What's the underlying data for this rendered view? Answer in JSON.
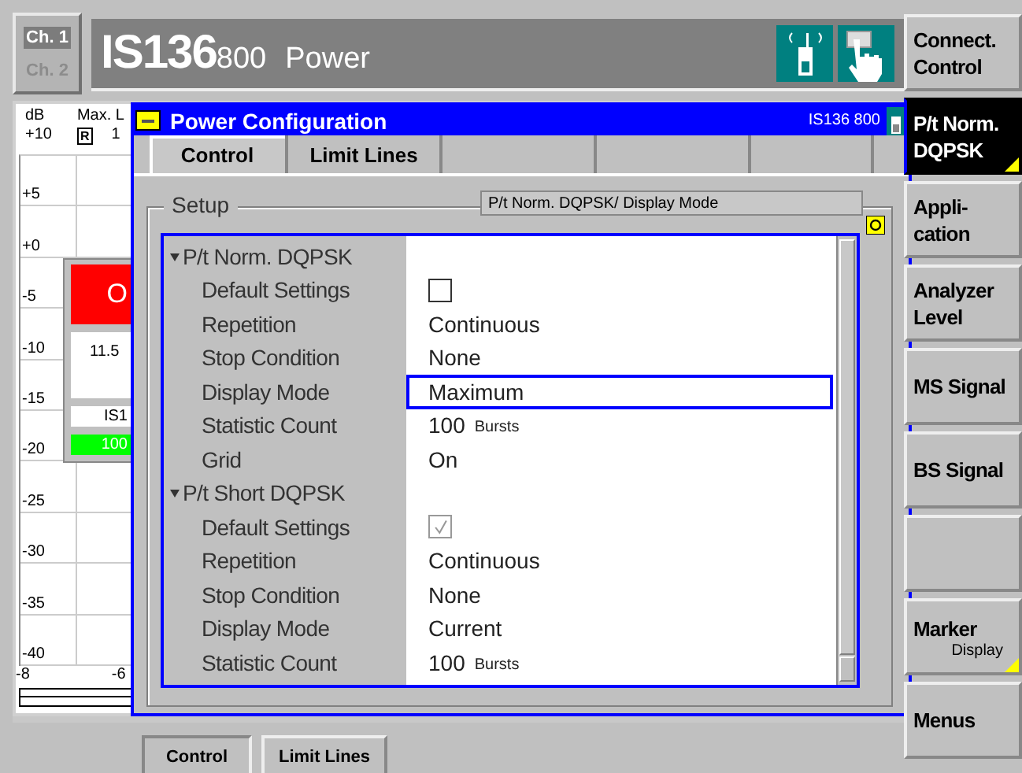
{
  "channels": [
    {
      "label": "Ch. 1",
      "selected": true
    },
    {
      "label": "Ch. 2",
      "selected": false
    }
  ],
  "header": {
    "standard": "IS136",
    "band": "800",
    "application": "Power"
  },
  "softkeys": [
    {
      "kind": "key",
      "lines": [
        "Connect.",
        "Control"
      ],
      "selected": false,
      "submenu": false
    },
    {
      "kind": "key",
      "lines": [
        "P/t Norm.",
        "DQPSK"
      ],
      "selected": true,
      "submenu": true
    },
    {
      "kind": "key",
      "lines": [
        "Appli-",
        "cation"
      ],
      "selected": false,
      "submenu": false
    },
    {
      "kind": "key",
      "lines": [
        "Analyzer",
        "Level"
      ],
      "selected": false,
      "submenu": false
    },
    {
      "kind": "key",
      "lines": [
        "MS Signal"
      ],
      "selected": false,
      "submenu": false
    },
    {
      "kind": "key",
      "lines": [
        "BS Signal"
      ],
      "selected": false,
      "submenu": false
    },
    {
      "kind": "blank"
    },
    {
      "kind": "key",
      "lines": [
        "Marker"
      ],
      "sub": "Display",
      "selected": false,
      "submenu": true
    },
    {
      "kind": "key",
      "lines": [
        "Menus"
      ],
      "selected": false,
      "submenu": false
    }
  ],
  "graph": {
    "unit": "dB",
    "trace_label": "Max. L",
    "marker_label": "R",
    "marker_value": "1",
    "top_label": "+10",
    "y_labels": [
      "+5",
      "+0",
      "-5",
      "-10",
      "-15",
      "-20",
      "-25",
      "-30",
      "-35",
      "-40"
    ],
    "x_labels": [
      "-8",
      "-6"
    ]
  },
  "result_box": {
    "status": "O",
    "reading": "11.5",
    "standard": "IS1",
    "count": "100"
  },
  "dialog": {
    "title": "Power Configuration",
    "tag": "IS136 800",
    "tabs": [
      {
        "label": "Control",
        "selected": true
      },
      {
        "label": "Limit Lines",
        "selected": false
      }
    ],
    "group": "Setup",
    "path": "P/t Norm. DQPSK/ Display Mode",
    "tree": [
      {
        "label": "P/t Norm. DQPSK",
        "expanded": true,
        "children": [
          {
            "label": "Default Settings",
            "kind": "checkbox",
            "checked": false,
            "disabled": false,
            "selected": false
          },
          {
            "label": "Repetition",
            "kind": "text",
            "value": "Continuous",
            "selected": false
          },
          {
            "label": "Stop Condition",
            "kind": "text",
            "value": "None",
            "selected": false
          },
          {
            "label": "Display Mode",
            "kind": "text",
            "value": "Maximum",
            "selected": true
          },
          {
            "label": "Statistic Count",
            "kind": "count",
            "value": "100",
            "unit": "Bursts",
            "selected": false
          },
          {
            "label": "Grid",
            "kind": "text",
            "value": "On",
            "selected": false
          }
        ]
      },
      {
        "label": "P/t Short DQPSK",
        "expanded": true,
        "children": [
          {
            "label": "Default Settings",
            "kind": "checkbox",
            "checked": true,
            "disabled": true,
            "selected": false
          },
          {
            "label": "Repetition",
            "kind": "text",
            "value": "Continuous",
            "selected": false
          },
          {
            "label": "Stop Condition",
            "kind": "text",
            "value": "None",
            "selected": false
          },
          {
            "label": "Display Mode",
            "kind": "text",
            "value": "Current",
            "selected": false
          },
          {
            "label": "Statistic Count",
            "kind": "count",
            "value": "100",
            "unit": "Bursts",
            "selected": false
          }
        ]
      }
    ]
  },
  "bottom_tabs": [
    {
      "label": "Control",
      "selected": true
    },
    {
      "label": "Limit Lines",
      "selected": false
    }
  ]
}
